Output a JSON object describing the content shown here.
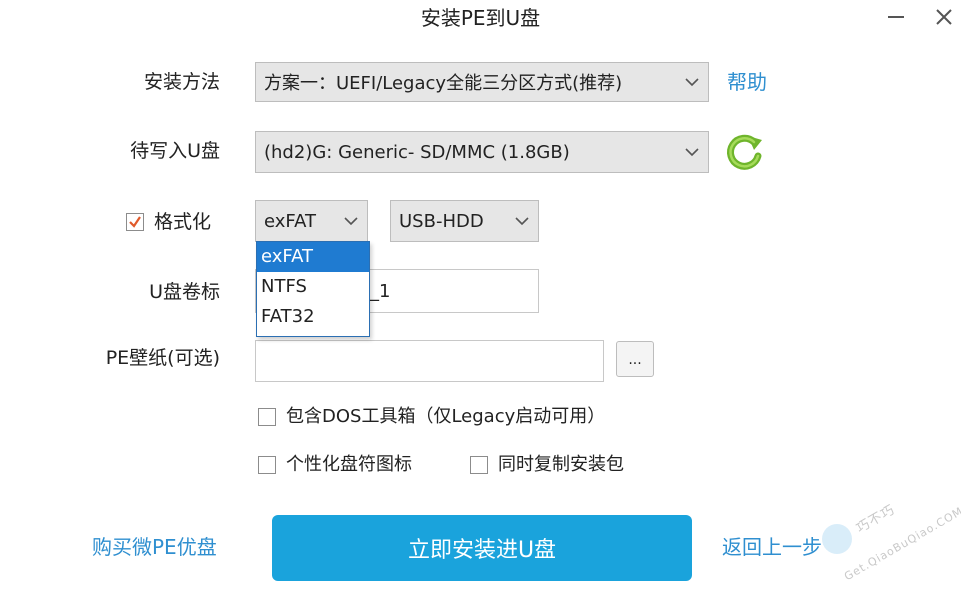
{
  "window": {
    "title": "安装PE到U盘"
  },
  "install_method": {
    "label": "安装方法",
    "value": "方案一：UEFI/Legacy全能三分区方式(推荐)",
    "help": "帮助"
  },
  "target_disk": {
    "label": "待写入U盘",
    "value": "(hd2)G: Generic- SD/MMC (1.8GB)"
  },
  "format": {
    "checkbox_label": "格式化",
    "checked": true,
    "fs_value": "exFAT",
    "fs_options": [
      "exFAT",
      "NTFS",
      "FAT32"
    ],
    "mode_value": "USB-HDD"
  },
  "volume_label": {
    "label": "U盘卷标",
    "value_visible": "_1"
  },
  "wallpaper": {
    "label": "PE壁纸(可选)",
    "value": "",
    "browse": "..."
  },
  "options": {
    "dos_tools": "包含DOS工具箱（仅Legacy启动可用）",
    "custom_icon": "个性化盘符图标",
    "copy_package": "同时复制安装包"
  },
  "footer": {
    "buy_link": "购买微PE优盘",
    "install_button": "立即安装进U盘",
    "back_link": "返回上一步"
  },
  "watermark": {
    "text1": "巧不巧",
    "text2": "Get.QiaoBuQiao.COM"
  },
  "colors": {
    "accent": "#1aa3dc",
    "link": "#2f8fd0",
    "refresh": "#7cc234",
    "selected": "#1f7bd1"
  }
}
